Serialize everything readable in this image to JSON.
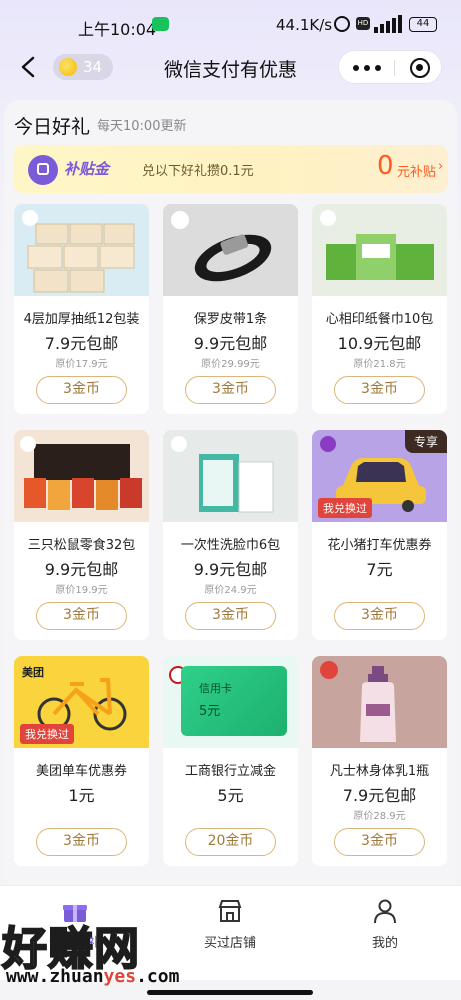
{
  "status_bar": {
    "time": "上午10:04",
    "network_speed": "44.1K/s",
    "hd": "HD",
    "battery": "44"
  },
  "nav": {
    "coins": "34",
    "title": "微信支付有优惠"
  },
  "section": {
    "title": "今日好礼",
    "subtitle": "每天10:00更新"
  },
  "subsidy": {
    "badge": "补贴金",
    "text": "兑以下好礼攒0.1元",
    "amount": "0",
    "unit": "元补贴",
    "arrow": "›"
  },
  "products": [
    {
      "name": "4层加厚抽纸12包装",
      "price": "7.9元包邮",
      "original": "原价17.9元",
      "button": "3金币",
      "icon": "tissue-pack-icon"
    },
    {
      "name": "保罗皮带1条",
      "price": "9.9元包邮",
      "original": "原价29.99元",
      "button": "3金币",
      "icon": "belt-icon"
    },
    {
      "name": "心相印纸餐巾10包",
      "price": "10.9元包邮",
      "original": "原价21.8元",
      "button": "3金币",
      "icon": "napkin-pack-icon"
    },
    {
      "name": "三只松鼠零食32包",
      "price": "9.9元包邮",
      "original": "原价19.9元",
      "button": "3金币",
      "icon": "snack-box-icon"
    },
    {
      "name": "一次性洗脸巾6包",
      "price": "9.9元包邮",
      "original": "原价24.9元",
      "button": "3金币",
      "icon": "face-towel-icon"
    },
    {
      "name": "花小猪打车优惠券",
      "price": "7元",
      "original": "",
      "button": "3金币",
      "icon": "taxi-car-icon",
      "tag_exclusive": "专享",
      "tag_redeemed": "我兑换过"
    },
    {
      "name": "美团单车优惠券",
      "price": "1元",
      "original": "",
      "button": "3金币",
      "icon": "bicycle-icon",
      "tag_redeemed": "我兑换过",
      "logo_text": "美团"
    },
    {
      "name": "工商银行立减金",
      "price": "5元",
      "original": "",
      "button": "20金币",
      "icon": "bank-card-icon",
      "card_label": "信用卡",
      "card_amount": "5元"
    },
    {
      "name": "凡士林身体乳1瓶",
      "price": "7.9元包邮",
      "original": "原价28.9元",
      "button": "3金币",
      "icon": "lotion-bottle-icon"
    }
  ],
  "tabs": [
    {
      "label": "今日好礼",
      "icon": "gift-icon",
      "active": true
    },
    {
      "label": "买过店铺",
      "icon": "store-icon"
    },
    {
      "label": "我的",
      "icon": "person-icon"
    }
  ],
  "watermark": {
    "brand": "好赚网",
    "url_a": "www.zhuan",
    "url_b": "yes",
    "url_c": ".com"
  },
  "colors": {
    "accent_purple": "#7a5bd8",
    "accent_orange": "#ff5a1f",
    "button_gold": "#dbb67a",
    "tag_red": "#e0443b"
  }
}
